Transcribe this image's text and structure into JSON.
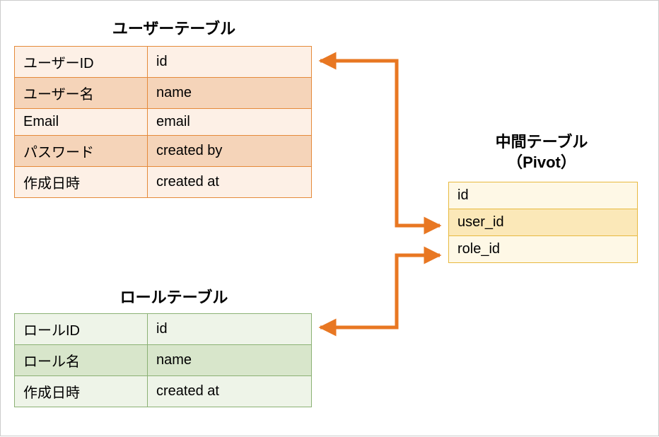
{
  "user_table": {
    "title": "ユーザーテーブル",
    "rows": [
      {
        "label": "ユーザーID",
        "col": "id"
      },
      {
        "label": "ユーザー名",
        "col": "name"
      },
      {
        "label": "Email",
        "col": "email"
      },
      {
        "label": "パスワード",
        "col": "created by"
      },
      {
        "label": "作成日時",
        "col": "created at"
      }
    ]
  },
  "role_table": {
    "title": "ロールテーブル",
    "rows": [
      {
        "label": "ロールID",
        "col": "id"
      },
      {
        "label": "ロール名",
        "col": "name"
      },
      {
        "label": "作成日時",
        "col": "created at"
      }
    ]
  },
  "pivot_table": {
    "title_line1": "中間テーブル",
    "title_line2": "（Pivot）",
    "rows": [
      {
        "col": "id"
      },
      {
        "col": "user_id"
      },
      {
        "col": "role_id"
      }
    ]
  },
  "colors": {
    "arrow": "#e87722",
    "user_border": "#e58a3a",
    "role_border": "#8bb174",
    "pivot_border": "#e8b93f"
  }
}
